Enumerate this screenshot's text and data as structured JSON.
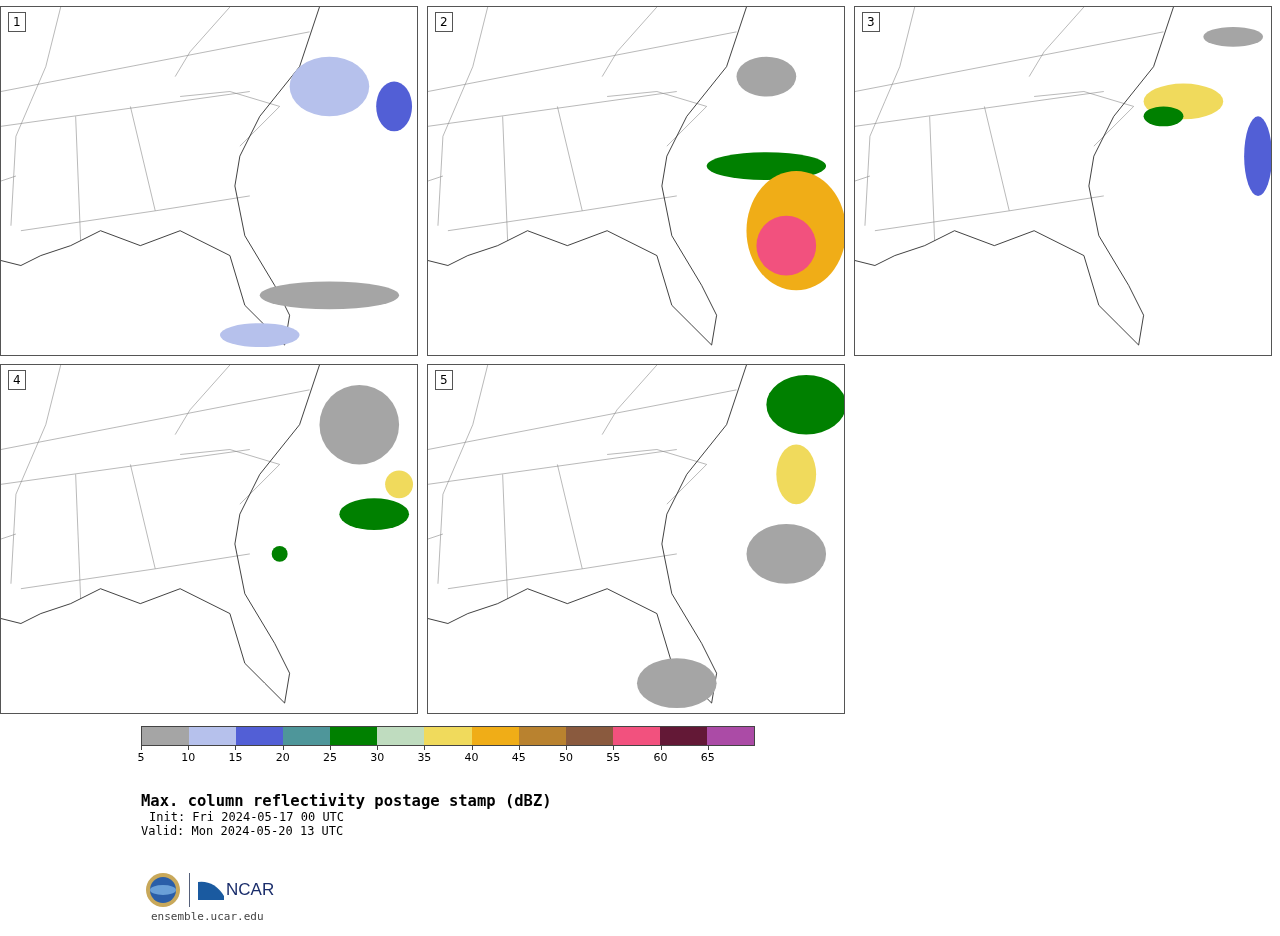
{
  "panels": [
    {
      "label": "1"
    },
    {
      "label": "2"
    },
    {
      "label": "3"
    },
    {
      "label": "4"
    },
    {
      "label": "5"
    }
  ],
  "colorbar": {
    "bins": [
      {
        "color": "#a5a5a5"
      },
      {
        "color": "#b6c1ec"
      },
      {
        "color": "#525fd6"
      },
      {
        "color": "#4e969a"
      },
      {
        "color": "#008000"
      },
      {
        "color": "#bfdcbf"
      },
      {
        "color": "#f0da5c"
      },
      {
        "color": "#f0ad17"
      },
      {
        "color": "#b9822f"
      },
      {
        "color": "#8a5a3e"
      },
      {
        "color": "#f2517e"
      },
      {
        "color": "#631836"
      },
      {
        "color": "#ab4ba6"
      }
    ],
    "ticks": [
      "5",
      "10",
      "15",
      "20",
      "25",
      "30",
      "35",
      "40",
      "45",
      "50",
      "55",
      "60",
      "65"
    ]
  },
  "title": "Max. column reflectivity postage stamp (dBZ)",
  "init": "Init: Fri 2024-05-17 00 UTC",
  "valid": "Valid: Mon 2024-05-20 13 UTC",
  "logo_text": "NCAR",
  "url": "ensemble.ucar.edu"
}
